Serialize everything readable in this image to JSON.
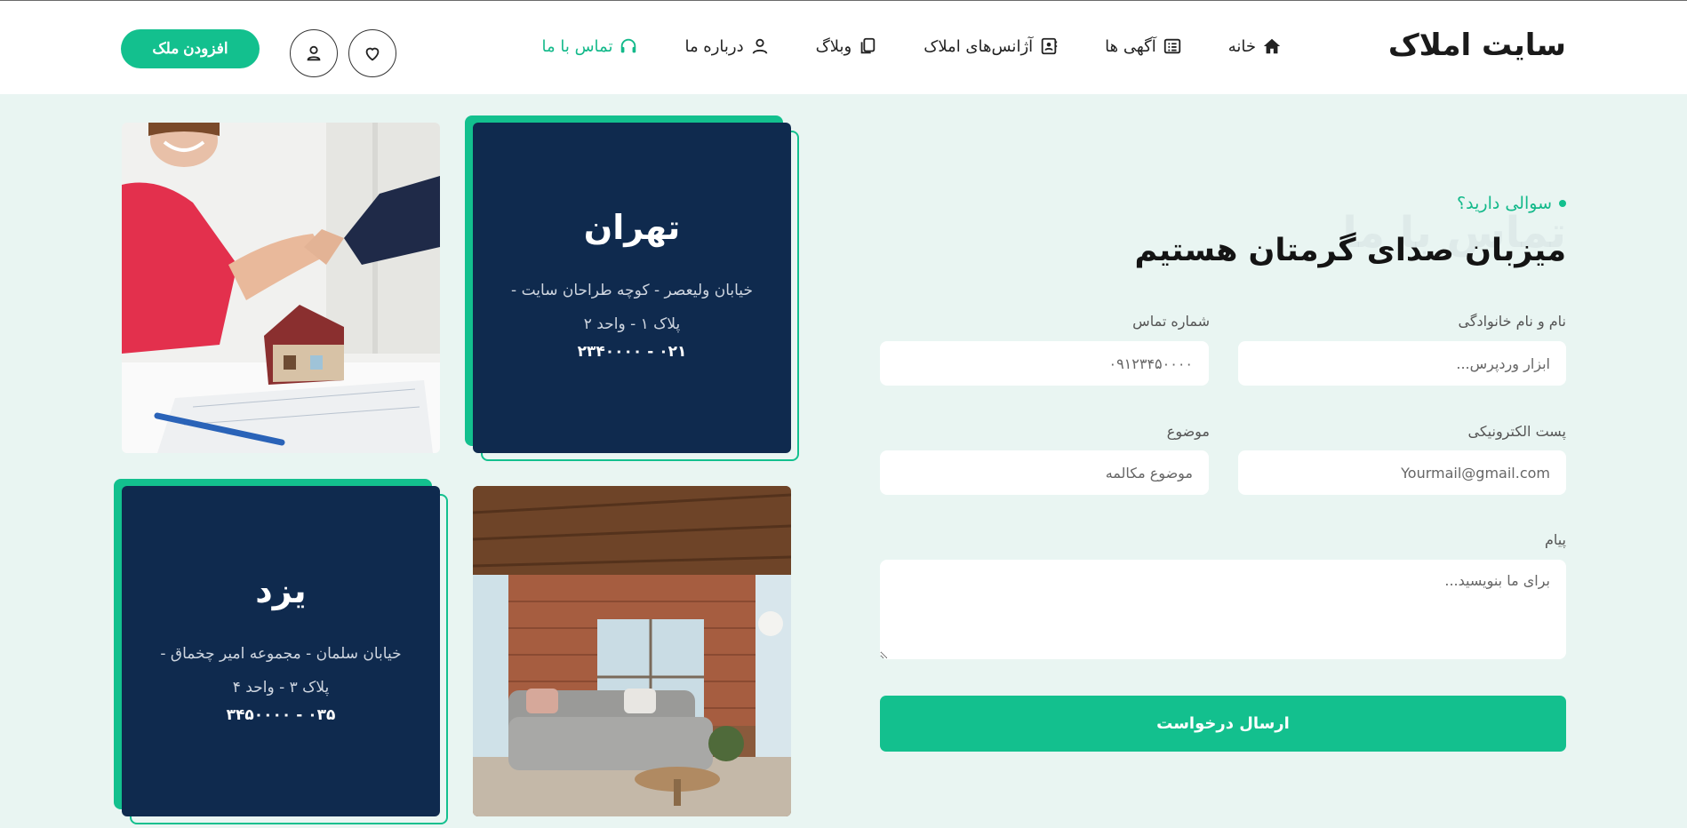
{
  "header": {
    "logo": "سایت املاک",
    "nav": [
      {
        "label": "خانه",
        "icon": "home-icon"
      },
      {
        "label": "آگهی ها",
        "icon": "list-icon"
      },
      {
        "label": "آژانس‌های املاک",
        "icon": "contact-card-icon"
      },
      {
        "label": "وبلاگ",
        "icon": "copy-icon"
      },
      {
        "label": "درباره ما",
        "icon": "user-icon"
      },
      {
        "label": "تماس با ما",
        "icon": "headset-icon",
        "active": true
      }
    ],
    "add_property_label": "افزودن ملک"
  },
  "offices": [
    {
      "city": "تهران",
      "address_line1": "خیابان ولیعصر - کوچه طراحان سایت -",
      "address_line2": "پلاک ۱ - واحد ۲",
      "phone": "۰۲۱ - ۲۳۴۰۰۰۰"
    },
    {
      "city": "یزد",
      "address_line1": "خیابان سلمان - مجموعه امیر چخماق -",
      "address_line2": "پلاک ۳ - واحد ۴",
      "phone": "۰۳۵ - ۳۴۵۰۰۰۰"
    }
  ],
  "contact": {
    "eyebrow": "سوالی دارید؟",
    "ghost_title": "تماس با ما",
    "title": "میزبان صدای گرمتان هستیم",
    "fields": {
      "name": {
        "label": "نام و نام خانوادگی",
        "placeholder": "ابزار وردپرس..."
      },
      "phone": {
        "label": "شماره تماس",
        "placeholder": "۰۹۱۲۳۴۵۰۰۰۰"
      },
      "email": {
        "label": "پست الکترونیکی",
        "placeholder": "Yourmail@gmail.com"
      },
      "subject": {
        "label": "موضوع",
        "placeholder": "موضوع مکالمه"
      },
      "message": {
        "label": "پیام",
        "placeholder": "برای ما بنویسید..."
      }
    },
    "submit_label": "ارسال درخواست"
  },
  "colors": {
    "accent": "#13c08e",
    "card": "#0f2a4e",
    "background": "#e9f5f2"
  }
}
